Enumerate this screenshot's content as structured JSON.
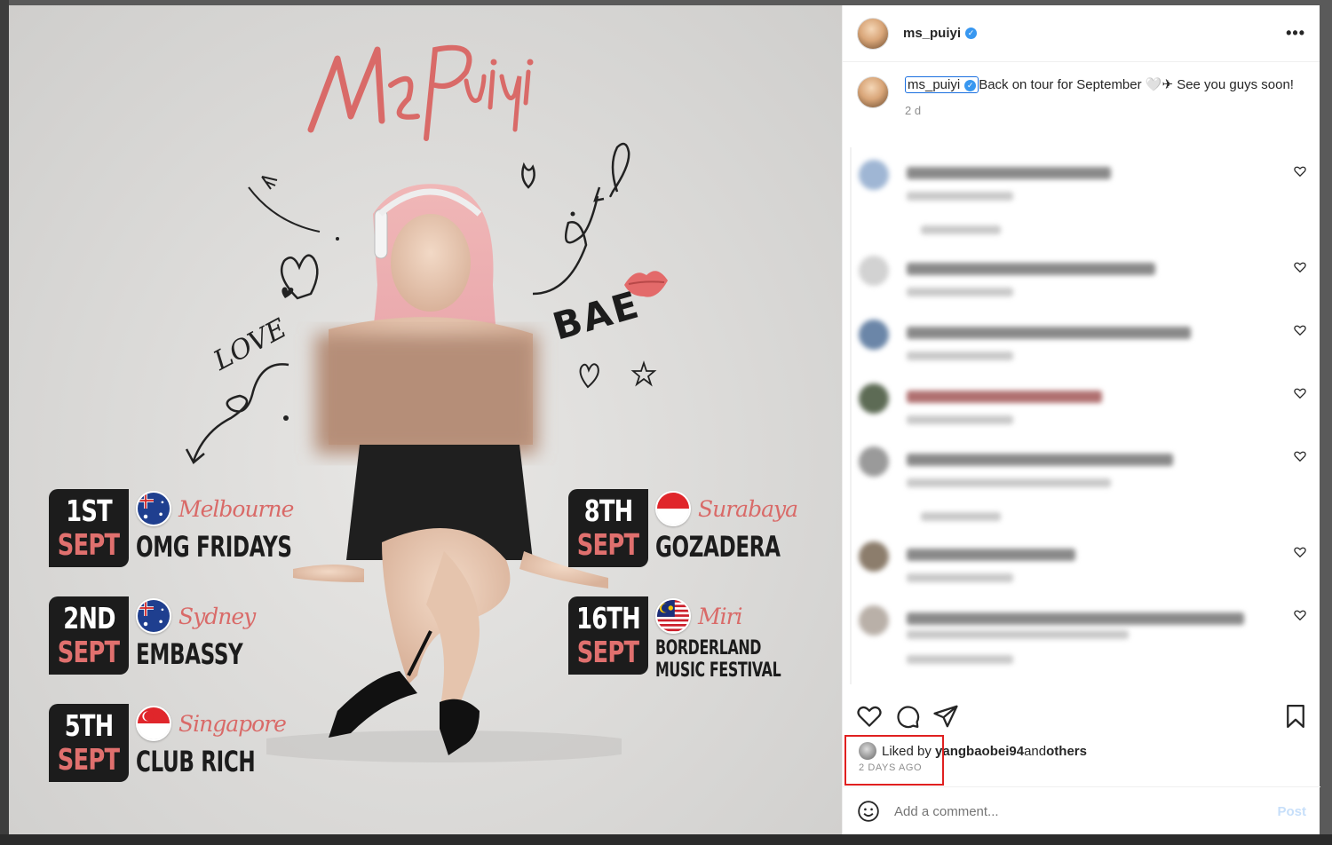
{
  "post": {
    "brand": "Ms Puiyi",
    "doodles": {
      "love": "LOVE",
      "bae": "BAE"
    },
    "events": [
      {
        "day": "1ST",
        "month": "SEPT",
        "city": "Melbourne",
        "venue": "OMG FRIDAYS",
        "flag": "australia"
      },
      {
        "day": "2ND",
        "month": "SEPT",
        "city": "Sydney",
        "venue": "EMBASSY",
        "flag": "australia"
      },
      {
        "day": "5TH",
        "month": "SEPT",
        "city": "Singapore",
        "venue": "CLUB RICH",
        "flag": "singapore"
      },
      {
        "day": "8TH",
        "month": "SEPT",
        "city": "Surabaya",
        "venue": "GOZADERA",
        "flag": "indonesia"
      },
      {
        "day": "16TH",
        "month": "SEPT",
        "city": "Miri",
        "venue_line1": "BORDERLAND",
        "venue_line2": "MUSIC FESTIVAL",
        "flag": "malaysia"
      }
    ]
  },
  "panel": {
    "header": {
      "username": "ms_puiyi",
      "verified": "✓",
      "more": "•••"
    },
    "caption": {
      "username": "ms_puiyi",
      "text": "Back on tour for September 🤍✈ See you guys soon!",
      "time": "2 d"
    },
    "liked_by": {
      "prefix": "Liked by ",
      "user": "yangbaobei94",
      "middle": " and ",
      "others": "others"
    },
    "posted_ago": "2 DAYS AGO",
    "comment_placeholder": "Add a comment...",
    "post_label": "Post",
    "icons": [
      "heart-icon",
      "comment-icon",
      "share-icon",
      "bookmark-icon",
      "emoji-icon"
    ],
    "colors": {
      "verified": "#3897f0",
      "highlight": "#e02020",
      "accent_pink": "#d96a68"
    }
  }
}
